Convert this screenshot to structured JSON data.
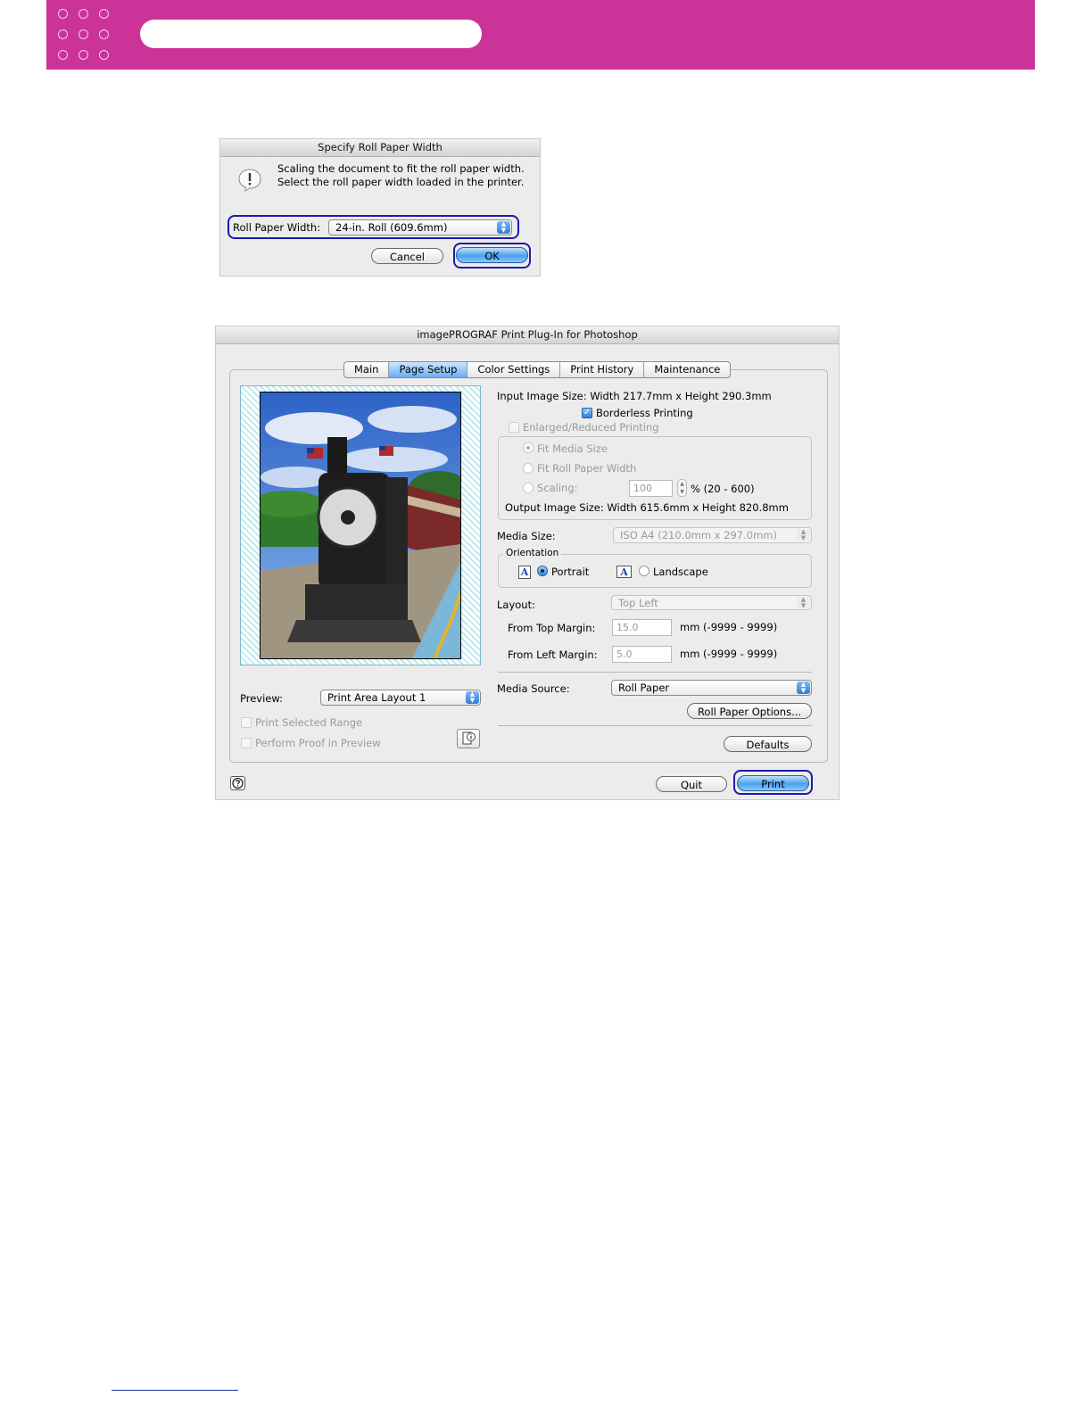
{
  "roll_dialog": {
    "title": "Specify Roll Paper Width",
    "message_line1": "Scaling the document to fit the roll paper width.",
    "message_line2": "Select the roll paper width loaded in the printer.",
    "roll_width_label": "Roll Paper Width:",
    "roll_width_value": "24-in. Roll (609.6mm)",
    "cancel_label": "Cancel",
    "ok_label": "OK"
  },
  "plugin_dialog": {
    "title": "imagePROGRAF Print Plug-In for Photoshop",
    "tabs": [
      "Main",
      "Page Setup",
      "Color Settings",
      "Print History",
      "Maintenance"
    ],
    "selected_tab": "Page Setup",
    "input_image_size": "Input Image Size: Width 217.7mm x Height 290.3mm",
    "borderless_label": "Borderless Printing",
    "enlarged_label": "Enlarged/Reduced Printing",
    "fit_media_label": "Fit Media Size",
    "fit_roll_label": "Fit Roll Paper Width",
    "scaling_label": "Scaling:",
    "scaling_value": "100",
    "scaling_range": "%  (20 - 600)",
    "output_image_size": "Output Image Size: Width 615.6mm x Height 820.8mm",
    "media_size_label": "Media Size:",
    "media_size_value": "ISO A4 (210.0mm x 297.0mm)",
    "orientation_label": "Orientation",
    "portrait_label": "Portrait",
    "landscape_label": "Landscape",
    "orientation_icon_letter": "A",
    "layout_label": "Layout:",
    "layout_value": "Top Left",
    "top_margin_label": "From Top Margin:",
    "top_margin_value": "15.0",
    "top_margin_range": "mm (-9999 - 9999)",
    "left_margin_label": "From Left Margin:",
    "left_margin_value": "5.0",
    "left_margin_range": "mm (-9999 - 9999)",
    "media_source_label": "Media Source:",
    "media_source_value": "Roll Paper",
    "roll_options_label": "Roll Paper Options...",
    "defaults_label": "Defaults",
    "preview_label": "Preview:",
    "preview_value": "Print Area Layout 1",
    "print_selected_label": "Print Selected Range",
    "perform_proof_label": "Perform Proof in Preview",
    "quit_label": "Quit",
    "print_label": "Print"
  },
  "colors": {
    "banner": "#cc3399",
    "focus": "#1a1ab0",
    "selected_tab": "#69aef3"
  }
}
